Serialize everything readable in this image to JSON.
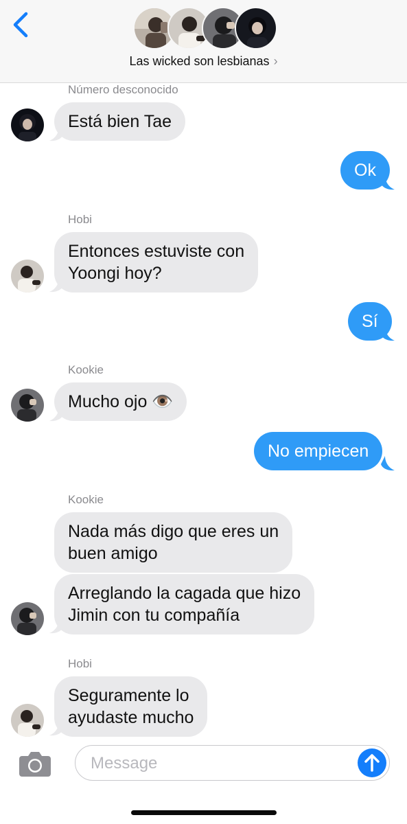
{
  "header": {
    "group_name": "Las wicked son lesbianas",
    "chevron": "›"
  },
  "messages": [
    {
      "sender": "Número desconocido",
      "text": "Está bien Tae"
    },
    {
      "text": "Ok"
    },
    {
      "sender": "Hobi",
      "text": "Entonces estuviste con Yoongi hoy?",
      "line1": "Entonces estuviste con",
      "line2": "Yoongi hoy?"
    },
    {
      "text": "Sí"
    },
    {
      "sender": "Kookie",
      "text": "Mucho ojo 👁️"
    },
    {
      "text": "No empiecen"
    },
    {
      "sender": "Kookie",
      "line1": "Nada más digo que eres un",
      "line2": "buen amigo"
    },
    {
      "line1": "Arreglando la cagada que hizo",
      "line2": "Jimin con tu compañía"
    },
    {
      "sender": "Hobi",
      "line1": "Seguramente lo",
      "line2": "ayudaste mucho"
    }
  ],
  "composer": {
    "placeholder": "Message",
    "camera_icon": "camera-icon",
    "send_icon": "arrow-up-icon"
  },
  "colors": {
    "accent": "#147efb",
    "outgoing_bubble": "#2f9bf7",
    "incoming_bubble": "#e9e9eb"
  }
}
